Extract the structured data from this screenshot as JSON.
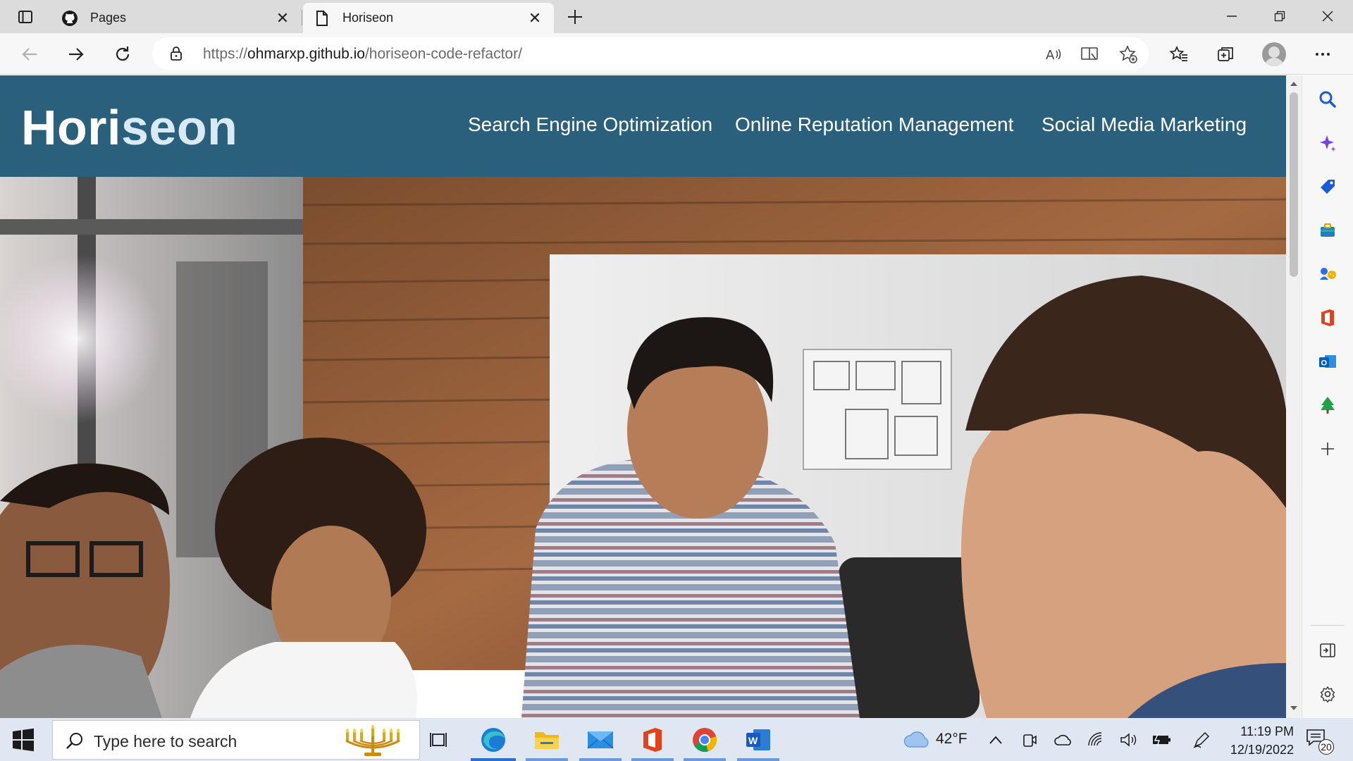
{
  "browser": {
    "tabs": [
      {
        "title": "Pages",
        "favicon": "github-icon",
        "active": false
      },
      {
        "title": "Horiseon",
        "favicon": "page-icon",
        "active": true
      }
    ],
    "address": {
      "scheme": "https://",
      "host": "ohmarxp.github.io",
      "path": "/horiseon-code-refactor/"
    }
  },
  "site": {
    "logo_main": "Hori",
    "logo_accent": "seon",
    "header_color": "#2a607c",
    "nav": [
      {
        "label": "Search Engine Optimization"
      },
      {
        "label": "Online Reputation Management"
      },
      {
        "label": "Social Media Marketing"
      }
    ]
  },
  "taskbar": {
    "search_placeholder": "Type here to search",
    "weather_temp": "42°F",
    "time": "11:19 PM",
    "date": "12/19/2022",
    "notification_count": "20"
  }
}
